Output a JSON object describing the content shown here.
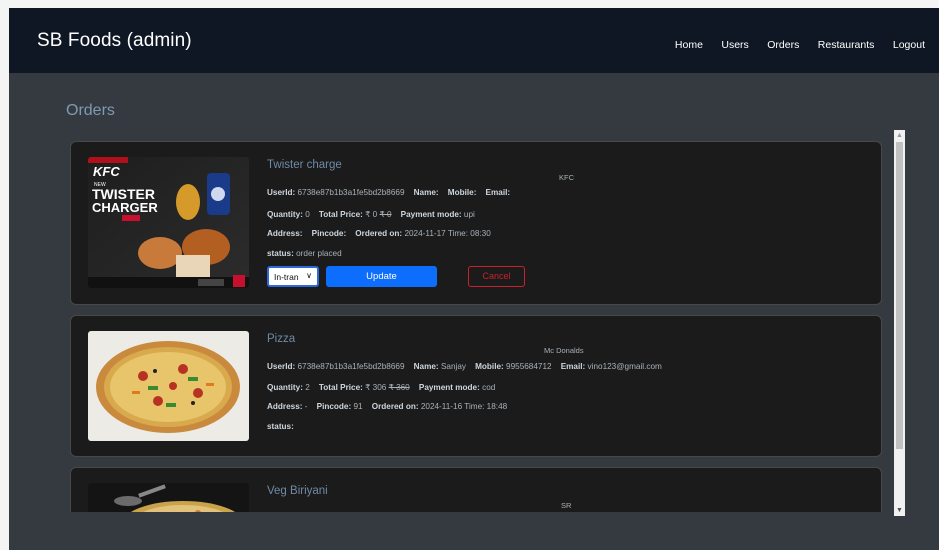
{
  "navbar": {
    "brand": "SB Foods (admin)",
    "links": [
      "Home",
      "Users",
      "Orders",
      "Restaurants",
      "Logout"
    ]
  },
  "page": {
    "heading": "Orders"
  },
  "labels": {
    "userid": "UserId:",
    "name": "Name:",
    "mobile": "Mobile:",
    "email": "Email:",
    "quantity": "Quantity:",
    "total_price": "Total Price:",
    "payment_mode": "Payment mode:",
    "address": "Address:",
    "pincode": "Pincode:",
    "ordered_on": "Ordered on:",
    "status": "status:"
  },
  "orders": [
    {
      "title": "Twister charge",
      "restaurant": "KFC",
      "userid": "6738e87b1b3a1fe5bd2b8669",
      "name": "",
      "mobile": "",
      "email": "",
      "quantity": "0",
      "price": "₹ 0",
      "price_old": "₹ 0",
      "payment": "upi",
      "address": "",
      "pincode": "",
      "ordered_on": "2024-11-17 Time: 08:30",
      "status": "order placed",
      "select_value": "In-tran",
      "update_label": "Update",
      "cancel_label": "Cancel",
      "image": "kfc-twister-charger-box-photo"
    },
    {
      "title": "Pizza",
      "restaurant": "Mc Donalds",
      "userid": "6738e87b1b3a1fe5bd2b8669",
      "name": "Sanjay",
      "mobile": "9955684712",
      "email": "vino123@gmail.com",
      "quantity": "2",
      "price": "₹ 306",
      "price_old": "₹ 360",
      "payment": "cod",
      "address": "-",
      "pincode": "91",
      "ordered_on": "2024-11-16 Time: 18:48",
      "status": "",
      "image": "pizza-photo"
    },
    {
      "title": "Veg Biriyani",
      "restaurant": "SR",
      "image": "veg-biriyani-photo"
    }
  ],
  "colors": {
    "navbar": "#0f1724",
    "page_bg": "#343a40",
    "card_bg": "#1b1b1b",
    "title": "#6f8aa7",
    "primary": "#0d6efd",
    "danger": "#c8232c"
  }
}
